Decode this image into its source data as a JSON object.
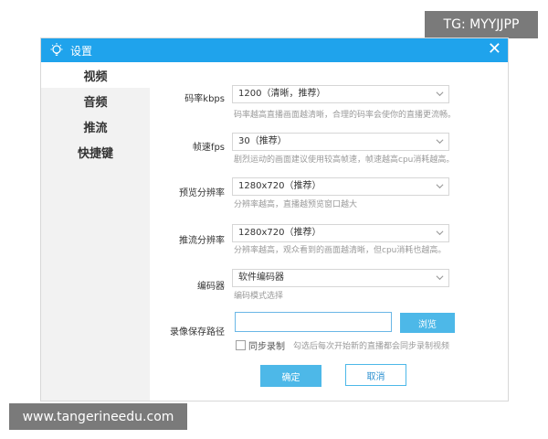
{
  "watermarks": {
    "top_right": "TG: MYYJJPP",
    "bottom_left": "www.tangerineedu.com"
  },
  "dialog": {
    "title": "设置",
    "close_glyph": "✕",
    "title_icon": "lightbulb-icon",
    "accent_color": "#1fa3ec"
  },
  "sidebar": {
    "items": [
      {
        "label": "视频",
        "active": true
      },
      {
        "label": "音频",
        "active": false
      },
      {
        "label": "推流",
        "active": false
      },
      {
        "label": "快捷键",
        "active": false
      }
    ]
  },
  "form": {
    "bitrate": {
      "label": "码率kbps",
      "value": "1200（清晰，推荐）",
      "hint": "码率越高直播画面越清晰，合理的码率会使你的直播更流畅。"
    },
    "fps": {
      "label": "帧速fps",
      "value": "30（推荐）",
      "hint": "剧烈运动的画面建议使用较高帧速，帧速越高cpu消耗越高。"
    },
    "preview_resolution": {
      "label": "预览分辨率",
      "value": "1280x720（推荐）",
      "hint": "分辨率越高，直播越预览窗口越大"
    },
    "stream_resolution": {
      "label": "推流分辨率",
      "value": "1280x720（推荐）",
      "hint": "分辨率越高，观众看到的画面越清晰，但cpu消耗也越高。"
    },
    "encoder": {
      "label": "编码器",
      "value": "软件编码器",
      "hint": "编码模式选择"
    },
    "record_path": {
      "label": "录像保存路径",
      "value": "",
      "browse_label": "浏览"
    },
    "sync_record": {
      "label": "同步录制",
      "checked": false,
      "hint": "勾选后每次开始新的直播都会同步录制视频"
    }
  },
  "buttons": {
    "ok": "确定",
    "cancel": "取消"
  }
}
